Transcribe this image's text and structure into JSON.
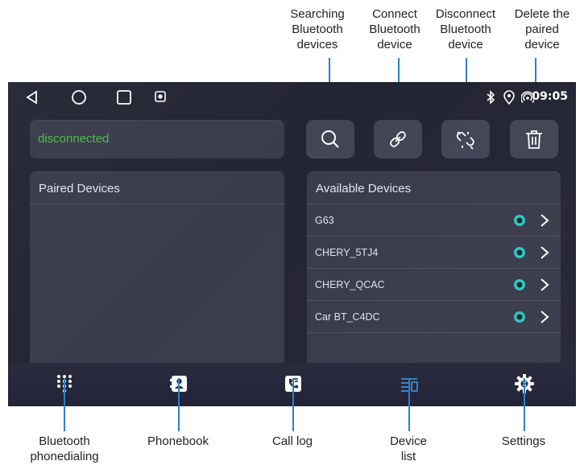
{
  "callouts": {
    "search": "Searching\nBluetooth\ndevices",
    "connect": "Connect\nBluetooth\ndevice",
    "disconnect": "Disconnect\nBluetooth\ndevice",
    "delete": "Delete the\npaired\ndevice",
    "dialing": "Bluetooth\nphonedialing",
    "phonebook": "Phonebook",
    "calllog": "Call log",
    "devicelist": "Device\nlist",
    "settings": "Settings"
  },
  "statusbar": {
    "time": "09:05"
  },
  "connection": {
    "status": "disconnected",
    "status_color": "#4fbf4a"
  },
  "paired": {
    "title": "Paired Devices",
    "devices": []
  },
  "available": {
    "title": "Available Devices",
    "devices": [
      {
        "name": "G63"
      },
      {
        "name": "CHERY_5TJ4"
      },
      {
        "name": "CHERY_QCAC"
      },
      {
        "name": "Car BT_C4DC"
      }
    ]
  },
  "tabs": {
    "dialing": "dialpad-icon",
    "phonebook": "contact-icon",
    "calllog": "call-log-icon",
    "devicelist": "device-list-icon",
    "settings": "settings-icon",
    "active": "devicelist",
    "accent": "#3a8fd8"
  },
  "colors": {
    "leader": "#2f7fc6",
    "device_dot": "#34c4c4"
  }
}
